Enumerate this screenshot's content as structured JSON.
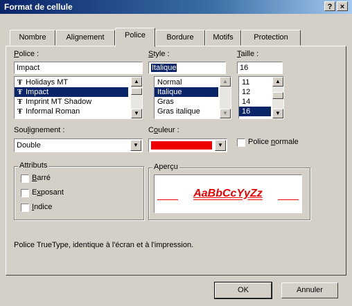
{
  "window": {
    "title": "Format de cellule",
    "help_label": "?",
    "close_label": "×"
  },
  "tabs": [
    {
      "label": "Nombre"
    },
    {
      "label": "Alignement"
    },
    {
      "label": "Police"
    },
    {
      "label": "Bordure"
    },
    {
      "label": "Motifs"
    },
    {
      "label": "Protection"
    }
  ],
  "active_tab": "Police",
  "police": {
    "label_prefix": "P",
    "label_rest": "olice :",
    "value": "Impact",
    "items": [
      {
        "icon": "Ŧ",
        "label": "Holidays MT",
        "selected": false
      },
      {
        "icon": "Ŧ",
        "label": "Impact",
        "selected": true
      },
      {
        "icon": "Ŧ",
        "label": "Imprint MT Shadow",
        "selected": false
      },
      {
        "icon": "Ŧ",
        "label": "Informal Roman",
        "selected": false
      }
    ]
  },
  "style": {
    "label_prefix": "S",
    "label_rest": "tyle :",
    "value": "Italique",
    "items": [
      {
        "label": "Normal",
        "selected": false
      },
      {
        "label": "Italique",
        "selected": true
      },
      {
        "label": "Gras",
        "selected": false
      },
      {
        "label": "Gras italique",
        "selected": false
      }
    ]
  },
  "taille": {
    "label_prefix": "T",
    "label_rest": "aille :",
    "value": "16",
    "items": [
      {
        "label": "11",
        "selected": false
      },
      {
        "label": "12",
        "selected": false
      },
      {
        "label": "14",
        "selected": false
      },
      {
        "label": "16",
        "selected": true
      }
    ]
  },
  "soulignement": {
    "label_pre": "Sou",
    "label_u": "l",
    "label_post": "ignement :",
    "value": "Double"
  },
  "couleur": {
    "label_pre": "C",
    "label_u": "o",
    "label_post": "uleur :",
    "swatch_color": "#ee0000"
  },
  "police_normale": {
    "label_pre": "Police ",
    "label_u": "n",
    "label_post": "ormale",
    "checked": false
  },
  "attributs": {
    "title": "Attributs",
    "items": [
      {
        "pre": "",
        "u": "B",
        "post": "arré",
        "checked": false
      },
      {
        "pre": "E",
        "u": "x",
        "post": "posant",
        "checked": false
      },
      {
        "pre": "",
        "u": "I",
        "post": "ndice",
        "checked": false
      }
    ]
  },
  "apercu": {
    "title": "Aperçu",
    "sample": "AaBbCcYyZz",
    "sample_color": "#ee0000"
  },
  "description": "Police TrueType, identique à l'écran et à l'impression.",
  "buttons": {
    "ok": "OK",
    "cancel": "Annuler"
  },
  "colors": {
    "title_bar": "#0a246a",
    "selection": "#0a246a",
    "face": "#d4d0c8"
  }
}
